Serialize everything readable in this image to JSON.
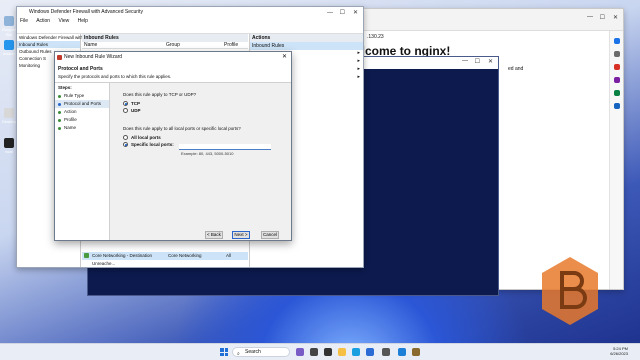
{
  "firewall": {
    "title": "Windows Defender Firewall with Advanced Security",
    "menu": [
      "File",
      "Action",
      "View",
      "Help"
    ],
    "tree": [
      "Windows Defender Firewall with",
      "Inbound Rules",
      "Outbound Rules",
      "Connection S",
      "Monitoring"
    ],
    "center_header": "Inbound Rules",
    "columns": [
      "Name",
      "Group",
      "Profile"
    ],
    "actions_header": "Actions",
    "actions_sub": "Inbound Rules",
    "last_row": {
      "name": "Core Networking - Destination Unreache...",
      "group": "Core Networking",
      "profile": "All"
    }
  },
  "wizard": {
    "title": "New Inbound Rule Wizard",
    "heading": "Protocol and Ports",
    "subheading": "Specify the protocols and ports to which this rule applies.",
    "steps_label": "Steps:",
    "steps": [
      "Rule Type",
      "Protocol and Ports",
      "Action",
      "Profile",
      "Name"
    ],
    "q_protocol": "Does this rule apply to TCP or UDP?",
    "tcp": "TCP",
    "udp": "UDP",
    "q_ports": "Does this rule apply to all local ports or specific local ports?",
    "all_ports": "All local ports",
    "specific_ports": "Specific local ports:",
    "ports_value": "",
    "example": "Example: 80, 443, 5000-5010",
    "back": "< Back",
    "next": "Next >",
    "cancel": "Cancel"
  },
  "browser": {
    "address": ".130.23",
    "heading_fragment": "elcome to nginx!",
    "text_fragment": "ed and"
  },
  "desktop_icons": [
    "Recycle Bin",
    "docker",
    "Desktop",
    "ncat"
  ],
  "taskbar": {
    "search_placeholder": "Search",
    "time": "5:24 PM",
    "date": "6/26/2023"
  },
  "colors": {
    "accent": "#2a66c9",
    "selection": "#cde3f7",
    "dark_window": "#0c1a4e",
    "watermark": "#e8792c"
  }
}
